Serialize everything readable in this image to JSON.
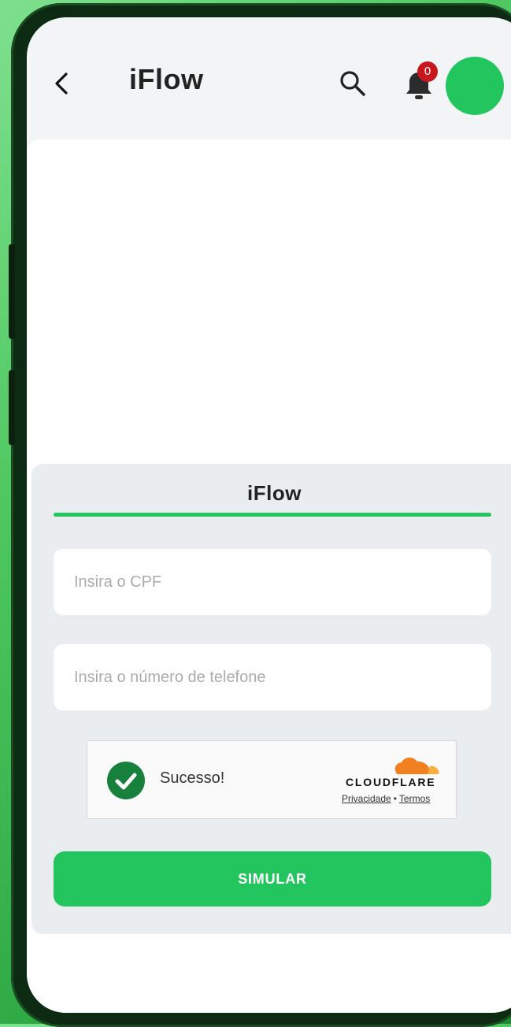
{
  "header": {
    "title": "iFlow",
    "notification_count": "0"
  },
  "form": {
    "title": "iFlow",
    "cpf_placeholder": "Insira o CPF",
    "phone_placeholder": "Insira o número de telefone",
    "submit_label": "SIMULAR"
  },
  "captcha": {
    "status_text": "Sucesso!",
    "brand": "CLOUDFLARE",
    "privacy_link": "Privacidade",
    "separator": "•",
    "terms_link": "Termos"
  },
  "colors": {
    "accent": "#22c55e",
    "badge": "#c8161d",
    "cloudflare_orange": "#f38020"
  },
  "icons": {
    "back": "back-arrow-icon",
    "search": "search-icon",
    "bell": "bell-icon",
    "check": "check-circle-icon",
    "cloud": "cloudflare-cloud-icon"
  }
}
